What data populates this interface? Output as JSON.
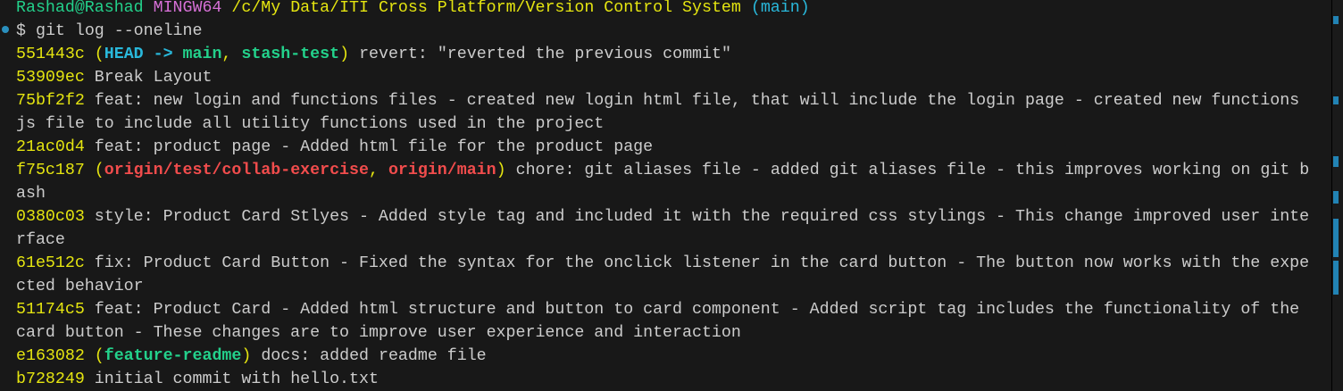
{
  "prompt": {
    "user": "Rashad@Rashad",
    "system": "MINGW64",
    "path": "/c/My Data/ITI Cross Platform/Version Control System",
    "branch": "(main)"
  },
  "command": {
    "symbol": "$",
    "text": "git log --oneline"
  },
  "commits": [
    {
      "hash": "551443c",
      "refs_open": "(",
      "head": "HEAD -> ",
      "locals": [
        "main",
        "stash-test"
      ],
      "remotes": [],
      "refs_close": ")",
      "message": "revert: \"reverted the previous commit\""
    },
    {
      "hash": "53909ec",
      "message": "Break Layout"
    },
    {
      "hash": "75bf2f2",
      "message": "feat: new login and functions files - created new login html file, that will include the login page - created new functions js file to include all utility functions used in the project"
    },
    {
      "hash": "21ac0d4",
      "message": "feat: product page - Added html file for the product page"
    },
    {
      "hash": "f75c187",
      "refs_open": "(",
      "remotes": [
        "origin/test/collab-exercise",
        "origin/main"
      ],
      "refs_close": ")",
      "message": "chore: git aliases file - added git aliases file - this improves working on git bash"
    },
    {
      "hash": "0380c03",
      "message": "style: Product Card Stlyes - Added style tag and included it with the required css stylings - This change improved user interface"
    },
    {
      "hash": "61e512c",
      "message": "fix: Product Card Button - Fixed the syntax for the onclick listener in the card button - The button now works with the expected behavior"
    },
    {
      "hash": "51174c5",
      "message": "feat: Product Card - Added html structure and button to card component - Added script tag includes the functionality of the card button - These changes are to improve user experience and interaction"
    },
    {
      "hash": "e163082",
      "refs_open": "(",
      "locals": [
        "feature-readme"
      ],
      "refs_close": ")",
      "message": "docs: added readme file"
    },
    {
      "hash": "b728249",
      "message": "initial commit with hello.txt"
    }
  ],
  "colors": {
    "background": "#181818",
    "text": "#cccccc",
    "hash": "#e5e510",
    "local_branch": "#23d18b",
    "remote_branch": "#f14c4c",
    "head": "#29b8db"
  }
}
